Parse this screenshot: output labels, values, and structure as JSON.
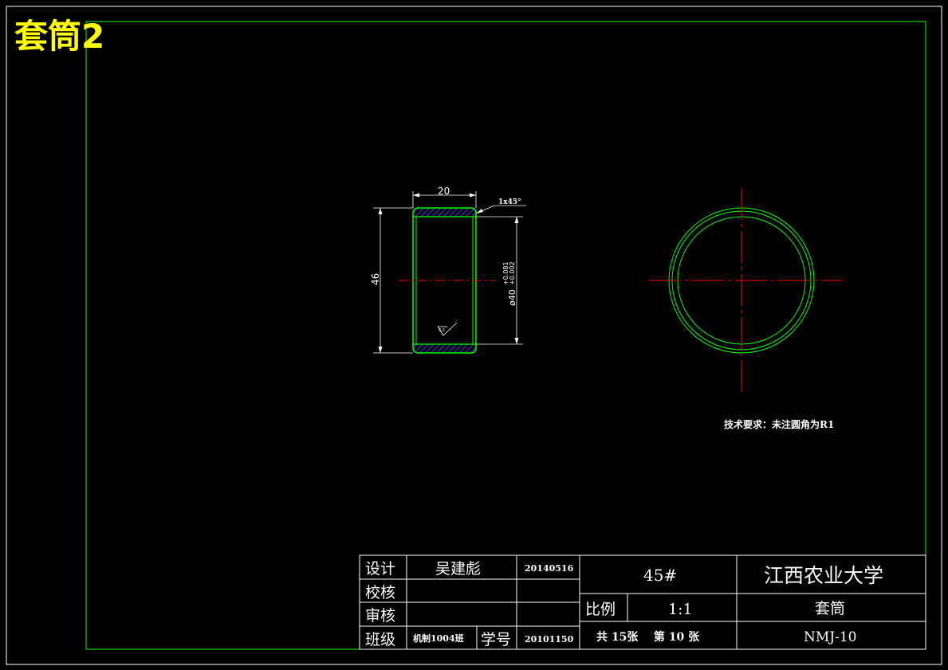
{
  "sheet_title": "套筒2",
  "dimensions": {
    "width": "20",
    "chamfer": "1x45°",
    "height": "46",
    "bore_prefix": "ø40",
    "tol_upper": "+0.081",
    "tol_lower": "+0.002",
    "roughness": "3.2"
  },
  "tech_requirements": "技术要求：未注圆角为R1",
  "title_block": {
    "design_label": "设计",
    "designer": "吴建彪",
    "design_date": "20140516",
    "check_label": "校核",
    "review_label": "审核",
    "class_label": "班级",
    "class_value": "机制1004班",
    "student_id_label": "学号",
    "student_id": "20101150",
    "material": "45#",
    "scale_label": "比例",
    "scale": "1:1",
    "sheets": "共 15张    第 10 张",
    "school": "江西农业大学",
    "part_name": "套筒",
    "drawing_number": "NMJ-10"
  },
  "colors": {
    "background": "#000000",
    "outline": "#00ff00",
    "centerline": "#ff0000",
    "text": "#ffffff",
    "title": "#ffff00",
    "hatch": "#3a3aff"
  }
}
